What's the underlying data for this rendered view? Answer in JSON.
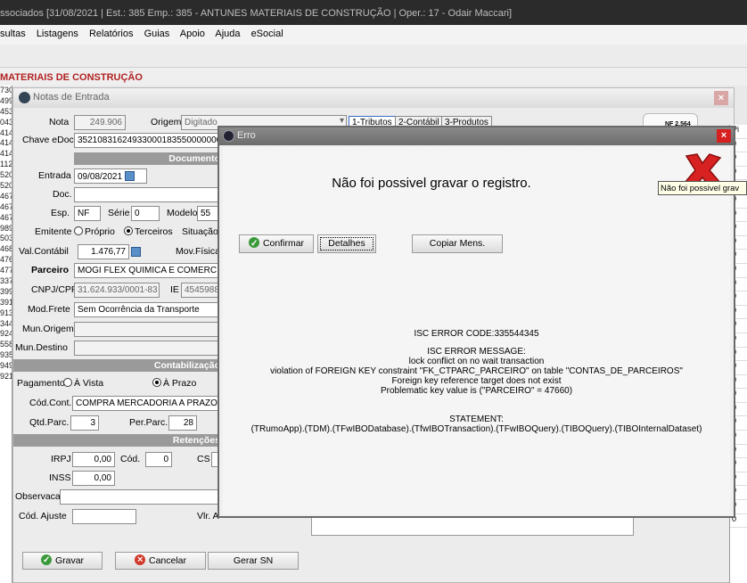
{
  "app_title": "ssociados [31/08/2021 | Est.: 385 Emp.: 385 - ANTUNES MATERIAIS DE CONSTRUÇÃO | Oper.: 17 - Odair Maccari]",
  "menu": [
    "sultas",
    "Listagens",
    "Relatórios",
    "Guias",
    "Apoio",
    "Ajuda",
    "eSocial"
  ],
  "company_banner": "MATERIAIS DE CONSTRUÇÃO",
  "left_column": [
    "730",
    "499",
    "453",
    "043",
    "414",
    "414",
    "414",
    "112",
    "520",
    "520",
    "467",
    "467",
    "467",
    "989",
    "503",
    "468",
    "476",
    "477",
    "337",
    "399",
    "391",
    "913",
    "344",
    "924",
    "558",
    "935",
    "949",
    "921"
  ],
  "right_column": [
    "Pi",
    "0",
    "0",
    "0",
    "0",
    "0",
    "0",
    "0",
    "0",
    "0",
    "0",
    "0",
    "0",
    "0",
    "0",
    "0",
    "0",
    "0",
    "0",
    "0",
    "0",
    "0",
    "0",
    "0",
    "0",
    "0",
    "0",
    "0",
    "0"
  ],
  "notas": {
    "title": "Notas de Entrada",
    "close": "×",
    "nota_label": "Nota",
    "nota_value": "249.906",
    "origem_label": "Origem",
    "origem_value": "Digitado",
    "tabs": [
      "1-Tributos",
      "2-Contábil",
      "3-Produtos"
    ],
    "nf_badge": "NF 2.564",
    "chave_label": "Chave eDoc",
    "chave_value": "35210831624933000183550000000",
    "documento_header": "Documento",
    "entrada_label": "Entrada",
    "entrada_value": "09/08/2021",
    "e_label": "E",
    "doc_label": "Doc.",
    "esp_label": "Esp.",
    "esp_value": "NF",
    "serie_label": "Série",
    "serie_value": "0",
    "modelo_label": "Modelo",
    "modelo_value": "55",
    "emitente_label": "Emitente",
    "emitente_opt1": "Próprio",
    "emitente_opt2": "Terceiros",
    "situacao_label": "Situação",
    "valcontabil_label": "Val.Contábil",
    "valcontabil_value": "1.476,77",
    "movfisica_label": "Mov.Física",
    "parceiro_label": "Parceiro",
    "parceiro_value": "MOGI FLEX QUIMICA E COMERCIO E",
    "cnpj_label": "CNPJ/CPF",
    "cnpj_value": "31.624.933/0001-83",
    "ie_label": "IE",
    "ie_value": "4545988",
    "modfrete_label": "Mod.Frete",
    "modfrete_value": "Sem Ocorrência da Transporte",
    "munorigem_label": "Mun.Origem",
    "mundestino_label": "Mun.Destino",
    "contab_header": "Contabilização",
    "pagamento_label": "Pagamento",
    "pag_opt1": "À Vista",
    "pag_opt2": "À Prazo",
    "codcont_label": "Cód.Cont.",
    "codcont_value": "COMPRA MERCADORIA A PRAZO",
    "qtdparc_label": "Qtd.Parc.",
    "qtdparc_value": "3",
    "perparc_label": "Per.Parc.",
    "perparc_value": "28",
    "retencoes_header": "Retenções",
    "irpj_label": "IRPJ",
    "irpj_value": "0,00",
    "cod_label": "Cód.",
    "cod_value": "0",
    "cs_label": "CS",
    "inss_label": "INSS",
    "inss_value": "0,00",
    "obs_label": "Observacao",
    "codajuste_label": "Cód. Ajuste",
    "vlra_label": "Vlr. A",
    "gravar_btn": "Gravar",
    "cancelar_btn": "Cancelar",
    "gerarsn_btn": "Gerar SN"
  },
  "erro": {
    "title": "Erro",
    "close": "×",
    "message": "Não foi possivel gravar o registro.",
    "tooltip": "Não foi possivel grav",
    "confirmar_btn": "Confirmar",
    "detalhes_btn": "Detalhes",
    "copiar_btn": "Copiar Mens.",
    "isc_code": "ISC ERROR CODE:335544345",
    "isc_msg_header": "ISC ERROR MESSAGE:",
    "isc_msg_lines": [
      "lock conflict on no wait transaction",
      "violation of FOREIGN KEY constraint \"FK_CTPARC_PARCEIRO\" on table \"CONTAS_DE_PARCEIROS\"",
      "Foreign key reference target does not exist",
      "Problematic key value is (\"PARCEIRO\" = 47660)"
    ],
    "statement_header": "STATEMENT:",
    "statement": "(TRumoApp).(TDM).(TFwIBODatabase).(TfwIBOTransaction).(TFwIBOQuery).(TIBOQuery).(TIBOInternalDataset)"
  }
}
